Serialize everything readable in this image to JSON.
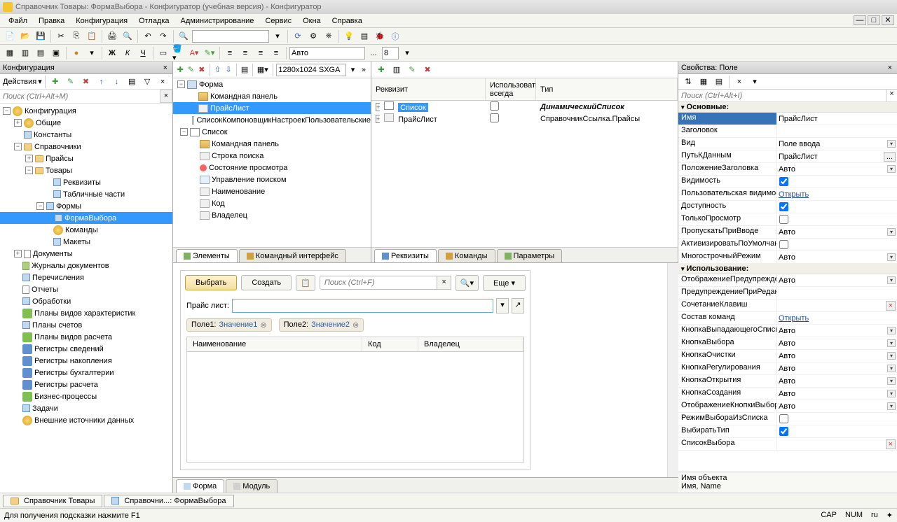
{
  "title": "Справочник Товары: ФормаВыбора - Конфигуратор (учебная версия) - Конфигуратор",
  "menu": [
    "Файл",
    "Правка",
    "Конфигурация",
    "Отладка",
    "Администрирование",
    "Сервис",
    "Окна",
    "Справка"
  ],
  "toolbar2": {
    "font": "Авто",
    "size": "8"
  },
  "centerToolbar": {
    "resolution": "1280x1024 SXGA"
  },
  "leftPanel": {
    "title": "Конфигурация",
    "actions": "Действия",
    "searchPlaceholder": "Поиск (Ctrl+Alt+M)",
    "tree": {
      "root": "Конфигурация",
      "items": [
        "Общие",
        "Константы",
        "Справочники"
      ],
      "spravochniki": {
        "praisy": "Прайсы",
        "tovary": {
          "label": "Товары",
          "children": [
            "Реквизиты",
            "Табличные части",
            "Формы"
          ],
          "formy": {
            "formaVybora": "ФормаВыбора"
          },
          "after": [
            "Команды",
            "Макеты"
          ]
        }
      },
      "rest": [
        "Документы",
        "Журналы документов",
        "Перечисления",
        "Отчеты",
        "Обработки",
        "Планы видов характеристик",
        "Планы счетов",
        "Планы видов расчета",
        "Регистры сведений",
        "Регистры накопления",
        "Регистры бухгалтерии",
        "Регистры расчета",
        "Бизнес-процессы",
        "Задачи",
        "Внешние источники данных"
      ]
    }
  },
  "formTree": {
    "root": "Форма",
    "items": [
      "Командная панель",
      "ПрайсЛист",
      "СписокКомпоновщикНастроекПользовательские",
      "Список",
      "Командная панель",
      "Строка поиска",
      "Состояние просмотра",
      "Управление поиском",
      "Наименование",
      "Код",
      "Владелец"
    ]
  },
  "formTreeTabs": [
    "Элементы",
    "Командный интерфейс"
  ],
  "reqPanel": {
    "headers": [
      "Реквизит",
      "Использовать всегда",
      "Тип"
    ],
    "rows": [
      {
        "name": "Список",
        "type": "ДинамическийСписок",
        "sel": true
      },
      {
        "name": "ПрайсЛист",
        "type": "СправочникСсылка.Прайсы",
        "sel": false
      }
    ],
    "tabs": [
      "Реквизиты",
      "Команды",
      "Параметры"
    ]
  },
  "preview": {
    "select": "Выбрать",
    "create": "Создать",
    "searchPlaceholder": "Поиск (Ctrl+F)",
    "more": "Еще",
    "fieldLabel": "Прайс лист:",
    "chips": [
      {
        "k": "Поле1:",
        "v": "Значение1"
      },
      {
        "k": "Поле2:",
        "v": "Значение2"
      }
    ],
    "columns": [
      "Наименование",
      "Код",
      "Владелец"
    ]
  },
  "previewTabs": [
    "Форма",
    "Модуль"
  ],
  "rightPanel": {
    "title": "Свойства: Поле",
    "searchPlaceholder": "Поиск (Ctrl+Alt+I)",
    "sections": {
      "main": "Основные:",
      "use": "Использование:"
    },
    "props": {
      "Imya": {
        "l": "Имя",
        "v": "ПрайсЛист"
      },
      "Zagolovok": {
        "l": "Заголовок",
        "v": ""
      },
      "Vid": {
        "l": "Вид",
        "v": "Поле ввода"
      },
      "PutKDannym": {
        "l": "ПутьКДанным",
        "v": "ПрайсЛист"
      },
      "PolozhenieZagolovka": {
        "l": "ПоложениеЗаголовка",
        "v": "Авто"
      },
      "Vidimost": {
        "l": "Видимость",
        "v": true
      },
      "PolzVidimost": {
        "l": "Пользовательская видимость",
        "v": "Открыть"
      },
      "Dostupnost": {
        "l": "Доступность",
        "v": true
      },
      "TolkoProsmotr": {
        "l": "ТолькоПросмотр",
        "v": false
      },
      "PropuskatPriVvode": {
        "l": "ПропускатьПриВводе",
        "v": "Авто"
      },
      "AktivizPoUmolch": {
        "l": "АктивизироватьПоУмолчанию",
        "v": false
      },
      "Mnogostroch": {
        "l": "МногострочныйРежим",
        "v": "Авто"
      },
      "OtobrPredupr": {
        "l": "ОтображениеПредупреждения",
        "v": "Авто"
      },
      "PredPriRedakt": {
        "l": "ПредупреждениеПриРедактир",
        "v": ""
      },
      "SochetKlavish": {
        "l": "СочетаниеКлавиш",
        "v": ""
      },
      "SostavKomand": {
        "l": "Состав команд",
        "v": "Открыть"
      },
      "KnopkaVypad": {
        "l": "КнопкаВыпадающегоСписка",
        "v": "Авто"
      },
      "KnopkaVybora": {
        "l": "КнопкаВыбора",
        "v": "Авто"
      },
      "KnopkaOchistki": {
        "l": "КнопкаОчистки",
        "v": "Авто"
      },
      "KnopkaRegul": {
        "l": "КнопкаРегулирования",
        "v": "Авто"
      },
      "KnopkaOtkr": {
        "l": "КнопкаОткрытия",
        "v": "Авто"
      },
      "KnopkaSozd": {
        "l": "КнопкаСоздания",
        "v": "Авто"
      },
      "OtobrKnopkiVyb": {
        "l": "ОтображениеКнопкиВыбора",
        "v": "Авто"
      },
      "RezhimVyboraIzSpiska": {
        "l": "РежимВыбораИзСписка",
        "v": false
      },
      "VybiratTip": {
        "l": "ВыбиратьТип",
        "v": true
      },
      "SpisokVybora": {
        "l": "СписокВыбора",
        "v": ""
      }
    },
    "desc": {
      "title": "Имя объекта",
      "sub": "Имя, Name"
    }
  },
  "bottomTabs": [
    "Справочник Товары",
    "Справочни...: ФормаВыбора"
  ],
  "status": {
    "hint": "Для получения подсказки нажмите F1",
    "ind": [
      "CAP",
      "NUM",
      "ru"
    ]
  }
}
